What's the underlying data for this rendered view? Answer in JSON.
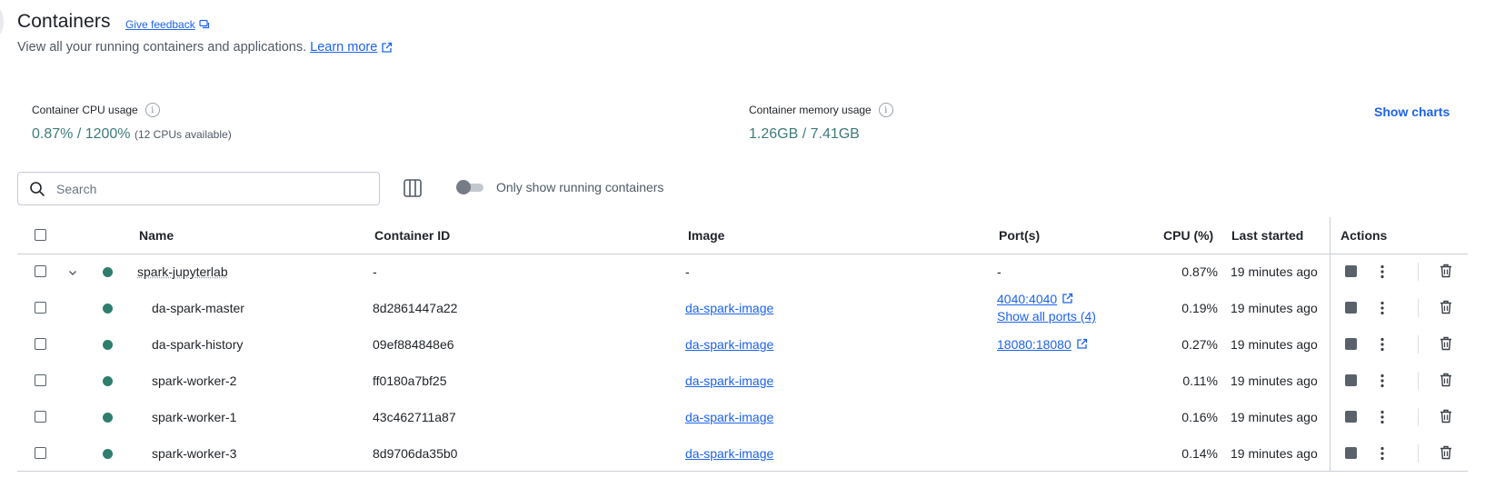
{
  "header": {
    "title": "Containers",
    "feedback_label": "Give feedback",
    "subtitle": "View all your running containers and applications.",
    "learn_more": "Learn more"
  },
  "stats": {
    "cpu": {
      "label": "Container CPU usage",
      "value": "0.87% / 1200%",
      "note": "(12 CPUs available)"
    },
    "memory": {
      "label": "Container memory usage",
      "value": "1.26GB / 7.41GB"
    },
    "show_charts": "Show charts"
  },
  "toolbar": {
    "search_placeholder": "Search",
    "toggle_label": "Only show running containers",
    "toggle_on": false
  },
  "table": {
    "columns": {
      "name": "Name",
      "container_id": "Container ID",
      "image": "Image",
      "ports": "Port(s)",
      "cpu": "CPU (%)",
      "last_started": "Last started",
      "actions": "Actions"
    },
    "rows": [
      {
        "name": "spark-jupyterlab",
        "id": "-",
        "image": "-",
        "port": "-",
        "port_extra": "",
        "cpu": "0.87%",
        "last": "19 minutes ago"
      },
      {
        "name": "da-spark-master",
        "id": "8d2861447a22",
        "image": "da-spark-image",
        "port": "4040:4040",
        "port_extra": "Show all ports (4)",
        "cpu": "0.19%",
        "last": "19 minutes ago"
      },
      {
        "name": "da-spark-history",
        "id": "09ef884848e6",
        "image": "da-spark-image",
        "port": "18080:18080",
        "port_extra": "",
        "cpu": "0.27%",
        "last": "19 minutes ago"
      },
      {
        "name": "spark-worker-2",
        "id": "ff0180a7bf25",
        "image": "da-spark-image",
        "port": "",
        "port_extra": "",
        "cpu": "0.11%",
        "last": "19 minutes ago"
      },
      {
        "name": "spark-worker-1",
        "id": "43c462711a87",
        "image": "da-spark-image",
        "port": "",
        "port_extra": "",
        "cpu": "0.16%",
        "last": "19 minutes ago"
      },
      {
        "name": "spark-worker-3",
        "id": "8d9706da35b0",
        "image": "da-spark-image",
        "port": "",
        "port_extra": "",
        "cpu": "0.14%",
        "last": "19 minutes ago"
      }
    ]
  },
  "colors": {
    "accent": "#1d63ed",
    "running": "#2f7d6e",
    "stat_value": "#3d7b7a"
  }
}
